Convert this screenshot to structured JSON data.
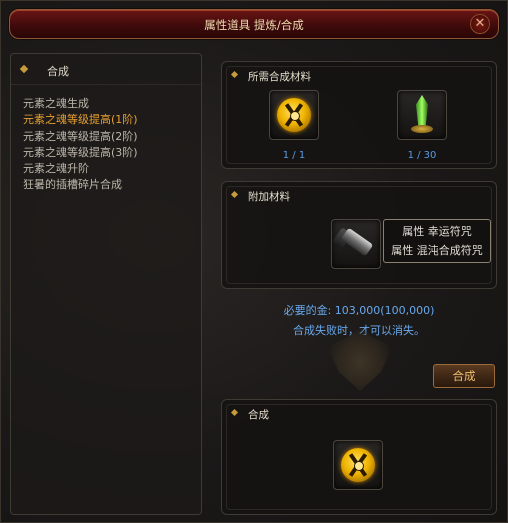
{
  "window": {
    "title": "属性道具 提炼/合成",
    "close_glyph": "✕"
  },
  "left": {
    "header": "合成",
    "items": [
      {
        "label": "元素之魂生成",
        "active": false
      },
      {
        "label": "元素之魂等级提高(1阶)",
        "active": true
      },
      {
        "label": "元素之魂等级提高(2阶)",
        "active": false
      },
      {
        "label": "元素之魂等级提高(3阶)",
        "active": false
      },
      {
        "label": "元素之魂升阶",
        "active": false
      },
      {
        "label": "狂暑的插槽碎片合成",
        "active": false
      }
    ]
  },
  "materials": {
    "header": "所需合成材料",
    "slots": [
      {
        "icon": "golden-element-soul-icon",
        "count": "1 / 1"
      },
      {
        "icon": "green-crystal-icon",
        "count": "1 / 30"
      }
    ]
  },
  "additional": {
    "header": "附加材料",
    "slot_icon": "scroll-item-icon",
    "tooltip": {
      "line1": "属性 幸运符咒",
      "line2": "属性 混沌合成符咒"
    }
  },
  "cost": {
    "gold_text": "必要的金: 103,000(100,000)",
    "fail_note": "合成失败时，才可以消失。"
  },
  "synth_button": "合成",
  "result": {
    "header": "合成",
    "slot_icon": "golden-element-soul-icon"
  },
  "colors": {
    "accent_gold": "#e8a030",
    "count_blue": "#5a9ae0",
    "title_red": "#6a1414"
  }
}
